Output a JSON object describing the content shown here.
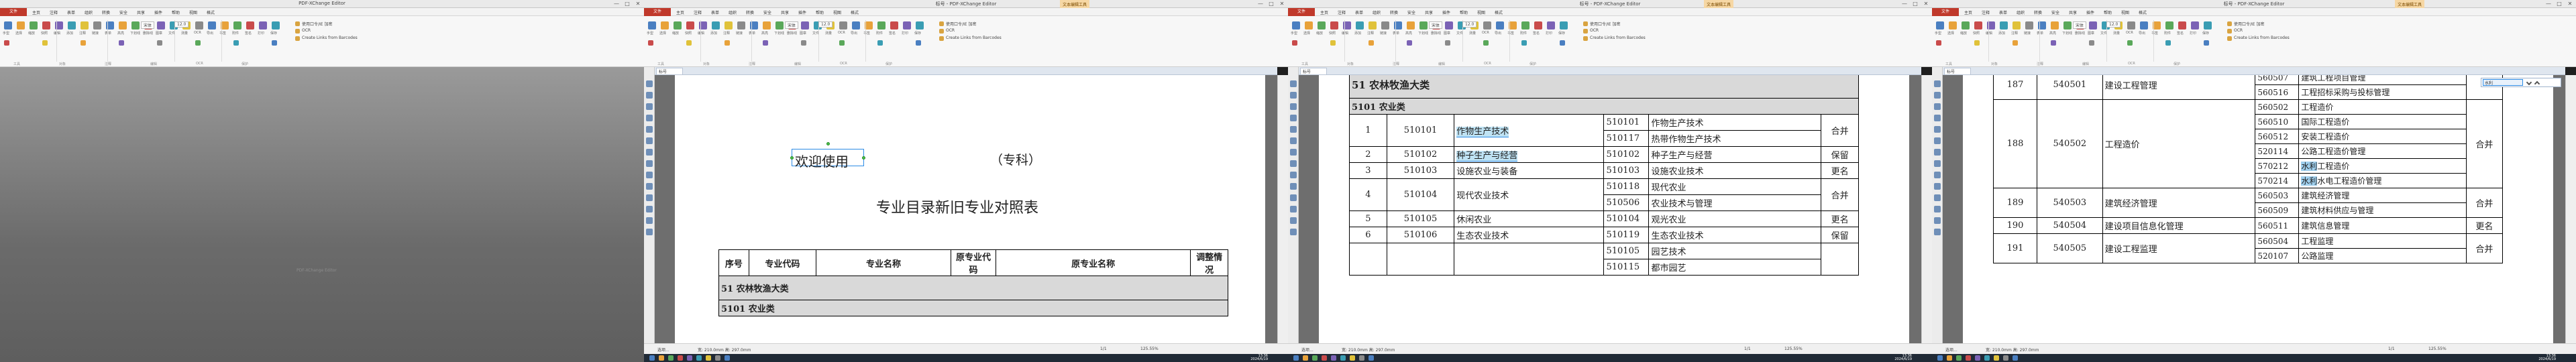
{
  "app": {
    "title": "PDF-XChange Editor",
    "titles": [
      "PDF-XChange Editor",
      "标号 - PDF-XChange Editor",
      "标号 - PDF-XChange Editor",
      "标号 - PDF-XChange Editor"
    ],
    "context_tab": "文本编辑工具",
    "doc_tab": "标号",
    "file_tab": "文件",
    "menus": [
      "主页",
      "注释",
      "表单",
      "组织",
      "转换",
      "安全",
      "共享",
      "插件",
      "帮助",
      "视图",
      "格式"
    ],
    "ribbon_buttons": [
      "手型",
      "选择",
      "缩放",
      "快照",
      "编辑",
      "添加",
      "注释",
      "链接",
      "表单",
      "高亮",
      "下划线",
      "删除线",
      "图章",
      "文件",
      "测量",
      "OCR",
      "导出",
      "书签",
      "附件",
      "签名",
      "打印",
      "保存"
    ],
    "ribbon_small": [
      "使用口令/IE 加密",
      "OCR",
      "Create Links from Barcodes",
      "Remove Encryption",
      "Clear Marks"
    ],
    "groups": [
      "工具",
      "对象",
      "注释",
      "编辑",
      "OCR",
      "保护"
    ],
    "fonts": [
      "宋体",
      "宋体(SimSun)",
      "12.0"
    ],
    "status": {
      "page": "1/1",
      "zoom": "125.55%",
      "coords": "宽: 210.0mm  高: 297.0mm",
      "options": "选项..."
    },
    "taskbar": {
      "time": "13:36",
      "date": "2024/6/19"
    },
    "watermark": "PDF-XChange Editor",
    "search": {
      "value": "水利"
    }
  },
  "screen2": {
    "welcome": "欢迎使用",
    "level": "（专科）",
    "subtitle": "专业目录新旧专业对照表",
    "headers": [
      "序号",
      "专业代码",
      "专业名称",
      "原专业代码",
      "原专业名称",
      "调整情况"
    ],
    "category": "51 农林牧渔大类",
    "subcategory": "5101 农业类"
  },
  "screen3": {
    "category": "51 农林牧渔大类",
    "subcategory": "5101 农业类",
    "rows": [
      {
        "no": "1",
        "code": "510101",
        "name": "作物生产技术",
        "old": [
          [
            "510101",
            "作物生产技术"
          ],
          [
            "510117",
            "热带作物生产技术"
          ]
        ],
        "status": "合并"
      },
      {
        "no": "2",
        "code": "510102",
        "name": "种子生产与经营",
        "old": [
          [
            "510102",
            "种子生产与经营"
          ]
        ],
        "status": "保留"
      },
      {
        "no": "3",
        "code": "510103",
        "name": "设施农业与装备",
        "old": [
          [
            "510103",
            "设施农业技术"
          ]
        ],
        "status": "更名"
      },
      {
        "no": "4",
        "code": "510104",
        "name": "现代农业技术",
        "old": [
          [
            "510118",
            "现代农业"
          ],
          [
            "510506",
            "农业技术与管理"
          ]
        ],
        "status": "合并"
      },
      {
        "no": "5",
        "code": "510105",
        "name": "休闲农业",
        "old": [
          [
            "510104",
            "观光农业"
          ]
        ],
        "status": "更名"
      },
      {
        "no": "6",
        "code": "510106",
        "name": "生态农业技术",
        "old": [
          [
            "510119",
            "生态农业技术"
          ]
        ],
        "status": "保留"
      },
      {
        "no": "",
        "code": "",
        "name": "",
        "old": [
          [
            "510105",
            "园艺技术"
          ],
          [
            "510115",
            "都市园艺"
          ]
        ],
        "status": ""
      }
    ]
  },
  "screen4": {
    "groups": [
      {
        "no": "187",
        "code": "540501",
        "name": "建设工程管理",
        "old": [
          [
            "560507",
            "建筑工程项目管理"
          ],
          [
            "560516",
            "工程招标采购与投标管理"
          ]
        ],
        "status": ""
      },
      {
        "no": "188",
        "code": "540502",
        "name": "工程造价",
        "old": [
          [
            "560502",
            "工程造价"
          ],
          [
            "560510",
            "国际工程造价"
          ],
          [
            "560512",
            "安装工程造价"
          ],
          [
            "520114",
            "公路工程造价管理"
          ],
          [
            "570212",
            "水利工程造价"
          ],
          [
            "570214",
            "水利水电工程造价管理"
          ]
        ],
        "status": "合并"
      },
      {
        "no": "189",
        "code": "540503",
        "name": "建筑经济管理",
        "old": [
          [
            "560503",
            "建筑经济管理"
          ],
          [
            "560509",
            "建筑材料供应与管理"
          ]
        ],
        "status": "合并"
      },
      {
        "no": "190",
        "code": "540504",
        "name": "建设项目信息化管理",
        "old": [
          [
            "560511",
            "建筑信息管理"
          ]
        ],
        "status": "更名"
      },
      {
        "no": "191",
        "code": "540505",
        "name": "建设工程监理",
        "old": [
          [
            "560504",
            "工程监理"
          ],
          [
            "520107",
            "公路监理"
          ]
        ],
        "status": "合并"
      }
    ]
  },
  "colors": {
    "accent": "#c0392b",
    "selection": "#2c8be5",
    "highlight": "#bfe3f4",
    "handle": "#4cc24c"
  }
}
